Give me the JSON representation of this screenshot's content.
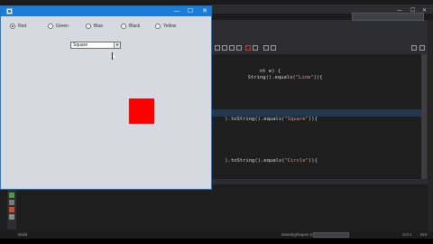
{
  "ide": {
    "code_lines": [
      {
        "pre": "            ",
        "code": "nt e) {",
        "str": ""
      },
      {
        "pre": "        ",
        "code": "String().equals(",
        "str": "\"Line\"",
        "post": ")){"
      },
      {
        "pre": "",
        "code": ").toString().equals(",
        "str": "\"Square\"",
        "post": ")){"
      },
      {
        "pre": "",
        "code": ").toString().equals(",
        "str": "\"Circle\"",
        "post": ")){"
      }
    ],
    "status_bar": {
      "left_text": "Build",
      "middle_text": "drawingshapes (run)",
      "position_text": "Col 1",
      "ins_text": "INS"
    }
  },
  "app": {
    "window_controls": {
      "minimize": "—",
      "maximize": "☐",
      "close": "✕"
    },
    "radios": [
      {
        "label": "Red",
        "selected": true
      },
      {
        "label": "Green",
        "selected": false
      },
      {
        "label": "Blue",
        "selected": false
      },
      {
        "label": "Black",
        "selected": false
      },
      {
        "label": "Yellow",
        "selected": false
      }
    ],
    "shape_select": {
      "value": "Square",
      "arrow": "▼"
    },
    "shape_color": "#ff0000"
  }
}
